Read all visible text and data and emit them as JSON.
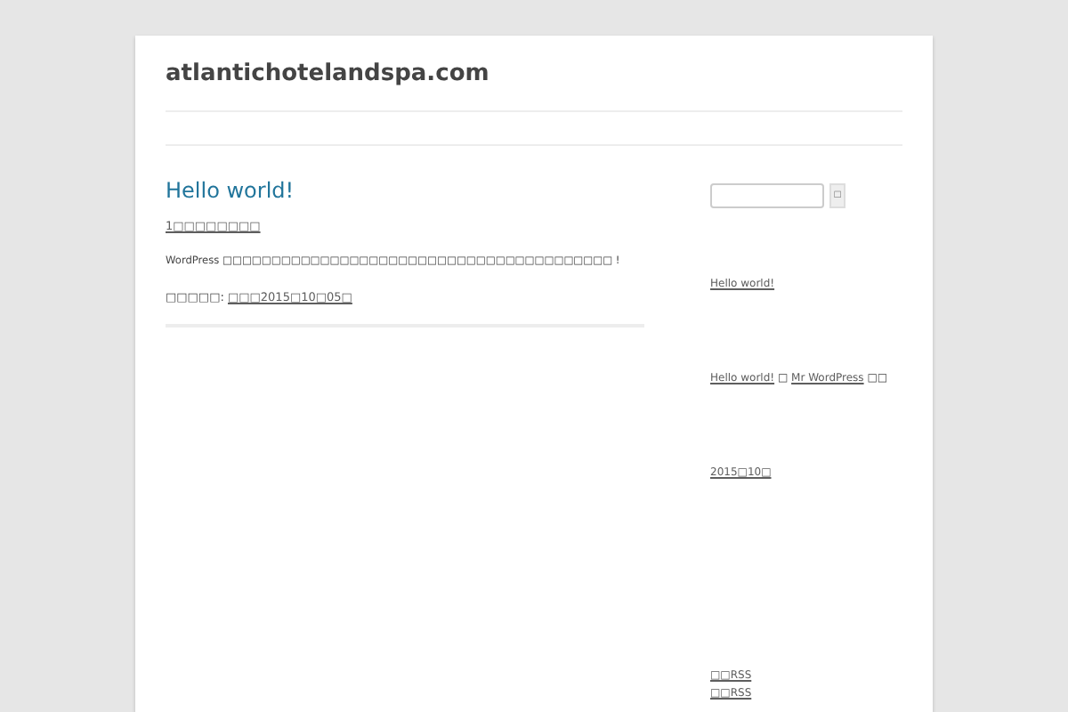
{
  "site_title": "atlantichotelandspa.com",
  "post": {
    "title": "Hello world!",
    "comments_link": "1□□□□□□□□",
    "content": "WordPress □□□□□□□□□□□□□□□□□□□□□□□□□□□□□□□□□□□□□□□□ !",
    "meta_label": "□□□□□:",
    "meta_link": "□□□2015□10□05□"
  },
  "sidebar": {
    "search": {
      "button": "□"
    },
    "widgets": [
      {
        "kind": "links",
        "items": [
          {
            "parts": [
              "Hello world!"
            ]
          }
        ]
      },
      {
        "kind": "links",
        "items": [
          {
            "parts": [
              "Hello world!",
              " □ ",
              "Mr WordPress",
              " □□"
            ]
          }
        ]
      },
      {
        "kind": "links",
        "items": [
          {
            "parts": [
              "2015□10□"
            ]
          }
        ]
      },
      {
        "kind": "links",
        "items": [
          {
            "parts": [
              "□□RSS"
            ]
          },
          {
            "parts": [
              "□□RSS"
            ]
          }
        ]
      }
    ]
  }
}
